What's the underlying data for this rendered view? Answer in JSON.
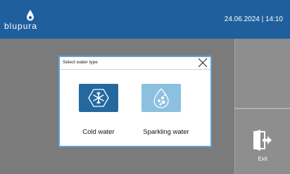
{
  "header": {
    "brand": "blupura",
    "datetime": "24.06.2024 | 14:10"
  },
  "dialog": {
    "title": "Select water type",
    "options": [
      {
        "label": "Cold water",
        "icon": "snowflake-icon"
      },
      {
        "label": "Sparkling water",
        "icon": "bubbles-icon"
      }
    ]
  },
  "sidebar": {
    "exit_label": "Exit"
  },
  "colors": {
    "header": "#1f5f9e",
    "background": "#7b7b7b",
    "cold_tile": "#23699f",
    "sparkling_tile": "#8bc0e0",
    "dialog_border": "#5ea3d8"
  }
}
